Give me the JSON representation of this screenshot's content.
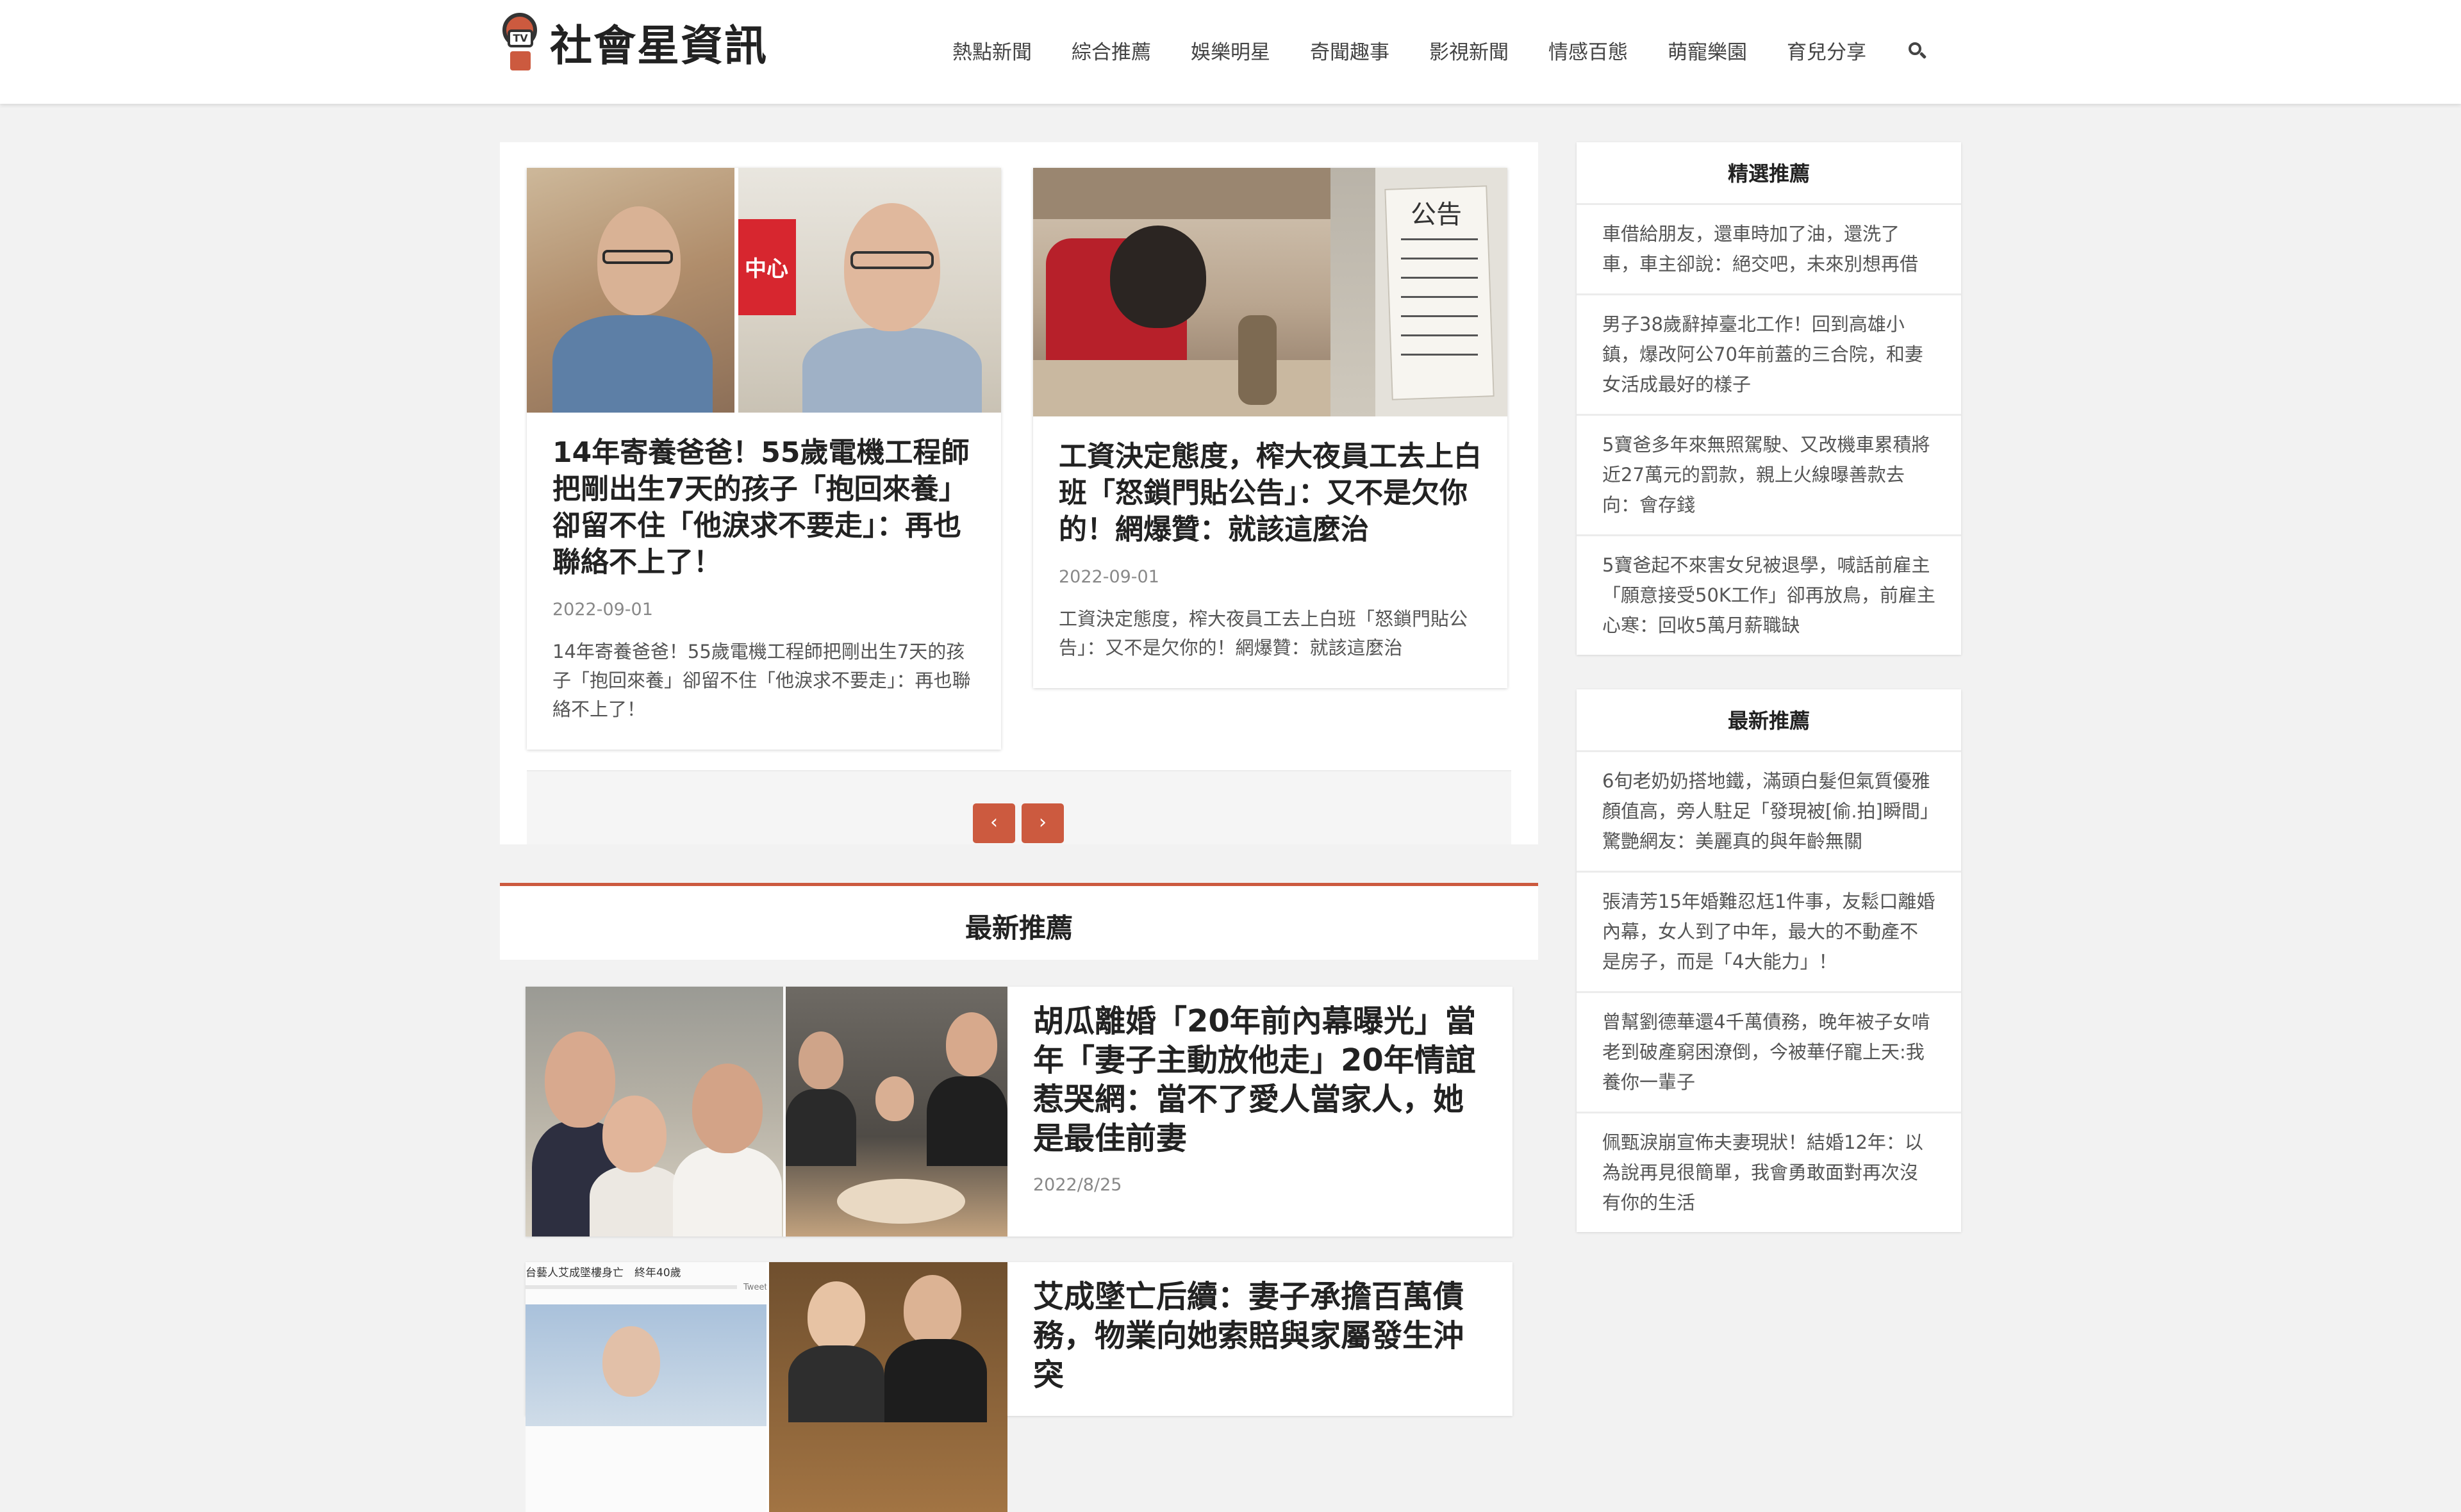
{
  "site": {
    "logo_text": "社會星資訊",
    "logo_badge": "TV"
  },
  "nav": {
    "items": [
      "熱點新聞",
      "綜合推薦",
      "娛樂明星",
      "奇聞趣事",
      "影視新聞",
      "情感百態",
      "萌寵樂園",
      "育兒分享"
    ],
    "search_icon": "search-icon"
  },
  "slider": {
    "cards": [
      {
        "title": "14年寄養爸爸！55歲電機工程師把剛出生7天的孩子「抱回來養」卻留不住「他淚求不要走」：再也聯絡不上了！",
        "date": "2022-09-01",
        "desc": "14年寄養爸爸！55歲電機工程師把剛出生7天的孩子「抱回來養」卻留不住「他淚求不要走」：再也聯絡不上了！",
        "image_text": "中心"
      },
      {
        "title": "工資決定態度，榨大夜員工去上白班「怒鎖門貼公告」：又不是欠你的！網爆贊：就該這麼治",
        "date": "2022-09-01",
        "desc": "工資決定態度，榨大夜員工去上白班「怒鎖門貼公告」：又不是欠你的！網爆贊：就該這麼治",
        "image_text": "公告"
      }
    ],
    "prev_label": "‹",
    "next_label": "›"
  },
  "latest": {
    "heading": "最新推薦",
    "posts": [
      {
        "title": "胡瓜離婚「20年前內幕曝光」當年「妻子主動放他走」20年情誼惹哭網：當不了愛人當家人，她是最佳前妻",
        "date": "2022/8/25"
      },
      {
        "title": "艾成墜亡后續：妻子承擔百萬債務，物業向她索賠與家屬發生沖突",
        "date": "",
        "image_caption": "台藝人艾成墜樓身亡　終年40歲",
        "image_tweet": "Tweet"
      }
    ]
  },
  "sidebar": {
    "featured": {
      "title": "精選推薦",
      "items": [
        "車借給朋友，還車時加了油，還洗了車，車主卻說：絕交吧，未來別想再借",
        "男子38歲辭掉臺北工作！回到高雄小鎮，爆改阿公70年前蓋的三合院，和妻女活成最好的樣子",
        "5寶爸多年來無照駕駛、又改機車累積將近27萬元的罰款，親上火線曝善款去向：會存錢",
        "5寶爸起不來害女兒被退學，喊話前雇主「願意接受50K工作」卻再放鳥，前雇主心寒：回收5萬月薪職缺"
      ]
    },
    "latest": {
      "title": "最新推薦",
      "items": [
        "6旬老奶奶搭地鐵，滿頭白髮但氣質優雅顏值高，旁人駐足「發現被[偷.拍]瞬間」驚艷網友：美麗真的與年齡無關",
        "張清芳15年婚難忍尪1件事，友鬆口離婚內幕，女人到了中年，最大的不動產不是房子，而是「4大能力」！",
        "曾幫劉德華還4千萬債務，晚年被子女啃老到破產窮困潦倒，今被華仔寵上天:我養你一輩子",
        "佩甄淚崩宣佈夫妻現狀！結婚12年：以為說再見很簡單，我會勇敢面對再次沒有你的生活"
      ]
    }
  },
  "colors": {
    "accent": "#cc5a3f",
    "page_bg": "#f2f2f2"
  }
}
